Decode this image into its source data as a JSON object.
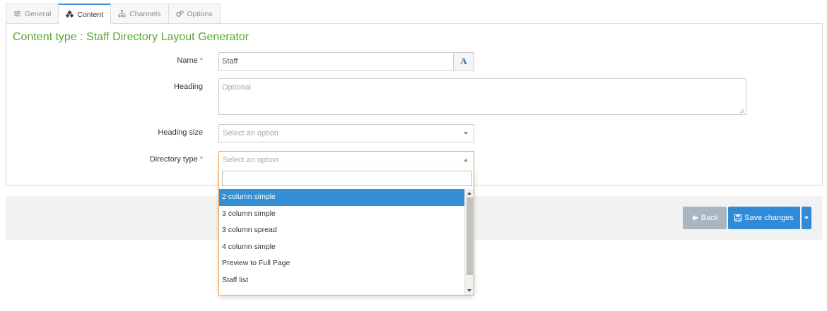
{
  "tabs": [
    {
      "label": "General",
      "icon": "sliders-icon",
      "active": false
    },
    {
      "label": "Content",
      "icon": "cubes-icon",
      "active": true
    },
    {
      "label": "Channels",
      "icon": "sitemap-icon",
      "active": false
    },
    {
      "label": "Options",
      "icon": "gears-icon",
      "active": false
    }
  ],
  "panel": {
    "title": "Content type : Staff Directory Layout Generator"
  },
  "form": {
    "name": {
      "label": "Name",
      "required_mark": "*",
      "value": "Staff",
      "addon_icon": "font-icon",
      "addon_glyph": "A"
    },
    "heading": {
      "label": "Heading",
      "placeholder": "Optional"
    },
    "heading_size": {
      "label": "Heading size",
      "placeholder": "Select an option"
    },
    "directory_type": {
      "label": "Directory type",
      "required_mark": "*",
      "placeholder": "Select an option"
    }
  },
  "dropdown": {
    "options": [
      "2 column simple",
      "3 column simple",
      "3 column spread",
      "4 column simple",
      "Preview to Full Page",
      "Staff list"
    ],
    "highlighted": "2 column simple"
  },
  "footer": {
    "back_label": "Back",
    "save_label": "Save changes"
  },
  "colors": {
    "accent": "#3390d6",
    "title_green": "#5aa632",
    "focus_orange": "#f0a24a",
    "back_gray": "#a9b5bf"
  }
}
